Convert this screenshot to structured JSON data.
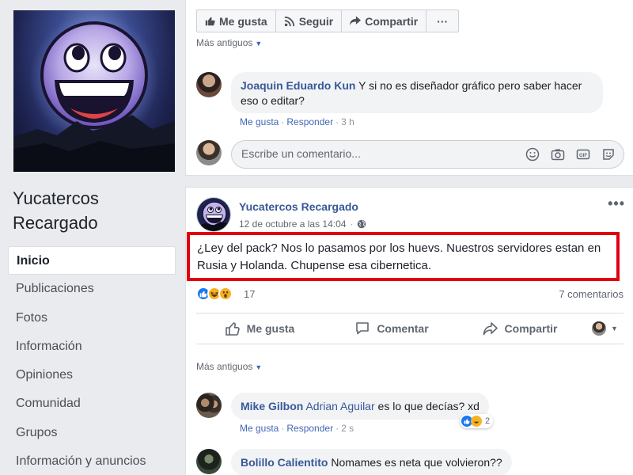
{
  "page": {
    "name": "Yucatercos Recargado",
    "nav": [
      "Inicio",
      "Publicaciones",
      "Fotos",
      "Información",
      "Opiniones",
      "Comunidad",
      "Grupos",
      "Información y anuncios"
    ]
  },
  "topbar": {
    "like": "Me gusta",
    "follow": "Seguir",
    "share": "Compartir",
    "more": "···"
  },
  "prev_comments": {
    "more_older": "Más antiguos",
    "comment": {
      "author": "Joaquin Eduardo Kun",
      "text": "Y si no es diseñador gráfico pero saber hacer eso o editar?",
      "like": "Me gusta",
      "reply": "Responder",
      "time": "3 h"
    },
    "composer_placeholder": "Escribe un comentario..."
  },
  "post": {
    "author": "Yucatercos Recargado",
    "time": "12 de octubre a las 14:04",
    "text": "¿Ley del pack? Nos lo pasamos por los huevs. Nuestros servidores estan en Rusia y Holanda. Chupense esa cibernetica.",
    "reaction_count": "17",
    "comment_count": "7 comentarios",
    "actions": {
      "like": "Me gusta",
      "comment": "Comentar",
      "share": "Compartir"
    },
    "more_older": "Más antiguos",
    "comments": [
      {
        "author": "Mike Gilbon",
        "mention": "Adrian Aguilar",
        "text": "es lo que decías? xd",
        "like": "Me gusta",
        "reply": "Responder",
        "time": "2 s",
        "reaction_count": "2"
      },
      {
        "author": "Bolillo Calientito",
        "text": "Nomames es neta que volvieron??"
      }
    ]
  },
  "colors": {
    "link": "#385898",
    "highlight_border": "#e0000f",
    "background": "#e9ebee"
  }
}
